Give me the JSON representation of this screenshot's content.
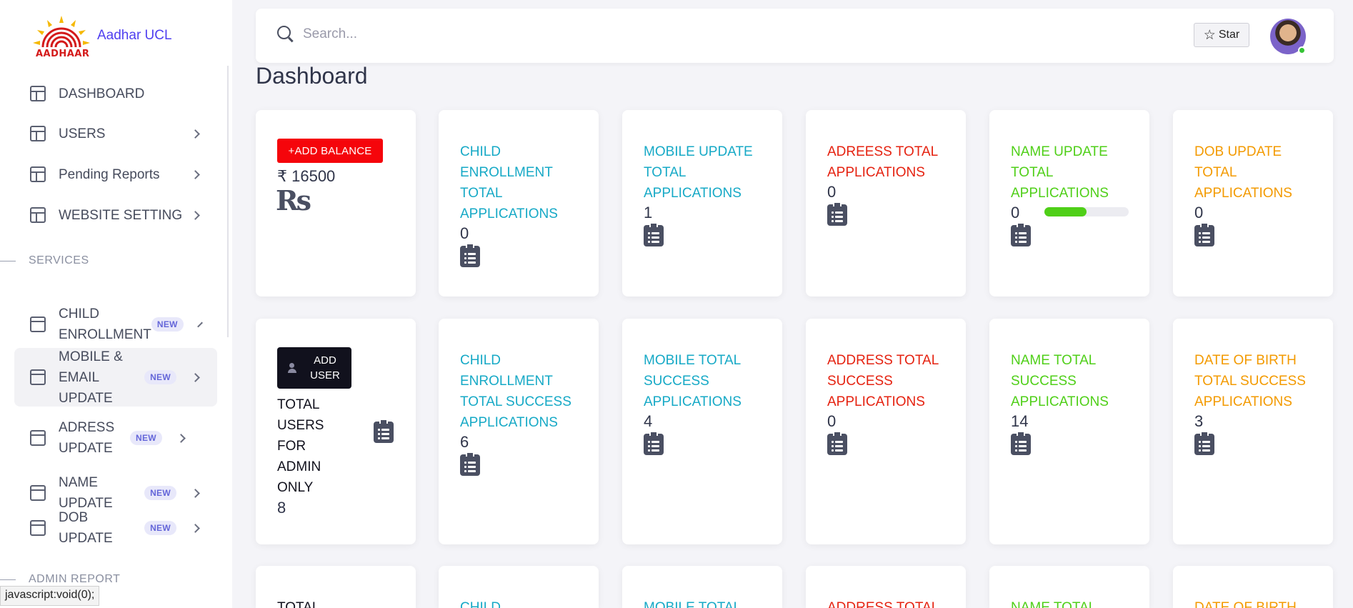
{
  "brand": {
    "logo_text": "AADHAAR",
    "name": "Aadhar UCL"
  },
  "sidebar": {
    "items": [
      {
        "label": "DASHBOARD"
      },
      {
        "label": "USERS"
      },
      {
        "label": "Pending Reports"
      },
      {
        "label": "WEBSITE SETTING"
      }
    ],
    "section_services": "SERVICES",
    "services": [
      {
        "label": "CHILD ENROLLMENT",
        "badge": "NEW"
      },
      {
        "label": "MOBILE & EMAIL UPDATE",
        "badge": "NEW"
      },
      {
        "label": "ADRESS UPDATE",
        "badge": "NEW"
      },
      {
        "label": "NAME UPDATE",
        "badge": "NEW"
      },
      {
        "label": "DOB UPDATE",
        "badge": "NEW"
      }
    ],
    "section_admin": "ADMIN REPORT"
  },
  "statusbar": "javascript:void(0);",
  "topbar": {
    "search_placeholder": "Search...",
    "star_label": "Star"
  },
  "page_title": "Dashboard",
  "balance_card": {
    "button": "+ADD BALANCE",
    "value": "₹ 16500",
    "currency": "Rs"
  },
  "row1": [
    {
      "title": "CHILD ENROLLMENT TOTAL APPLICATIONS",
      "value": "0",
      "color": "#16a9c6"
    },
    {
      "title": "MOBILE UPDATE TOTAL APPLICATIONS",
      "value": "1",
      "color": "#16a9c6"
    },
    {
      "title": "ADREESS TOTAL APPLICATIONS",
      "value": "0",
      "color": "#e52210"
    },
    {
      "title": "NAME UPDATE TOTAL APPLICATIONS",
      "value": "0",
      "color": "#4fcf18",
      "progress": 0.5
    },
    {
      "title": "DOB UPDATE TOTAL APPLICATIONS",
      "value": "0",
      "color": "#f39a00"
    }
  ],
  "users_card": {
    "button": "ADD USER",
    "label": "TOTAL USERS FOR ADMIN ONLY",
    "value": "8"
  },
  "row2": [
    {
      "title": "CHILD ENROLLMENT TOTAL SUCCESS APPLICATIONS",
      "value": "6",
      "color": "#16a9c6"
    },
    {
      "title": "MOBILE TOTAL SUCCESS APPLICATIONS",
      "value": "4",
      "color": "#16a9c6"
    },
    {
      "title": "ADDRESS TOTAL SUCCESS APPLICATIONS",
      "value": "0",
      "color": "#e52210"
    },
    {
      "title": "NAME TOTAL SUCCESS APPLICATIONS",
      "value": "14",
      "color": "#4fcf18"
    },
    {
      "title": "DATE OF BIRTH TOTAL SUCCESS APPLICATIONS",
      "value": "3",
      "color": "#f39a00"
    }
  ],
  "row3": [
    {
      "title": "TOTAL"
    },
    {
      "title": "CHILD",
      "color": "#16a9c6"
    },
    {
      "title": "MOBILE TOTAL",
      "color": "#16a9c6"
    },
    {
      "title": "ADDRESS TOTAL",
      "color": "#e52210"
    },
    {
      "title": "NAME TOTAL",
      "color": "#4fcf18"
    },
    {
      "title": "DATE OF BIRTH",
      "color": "#f39a00"
    }
  ]
}
